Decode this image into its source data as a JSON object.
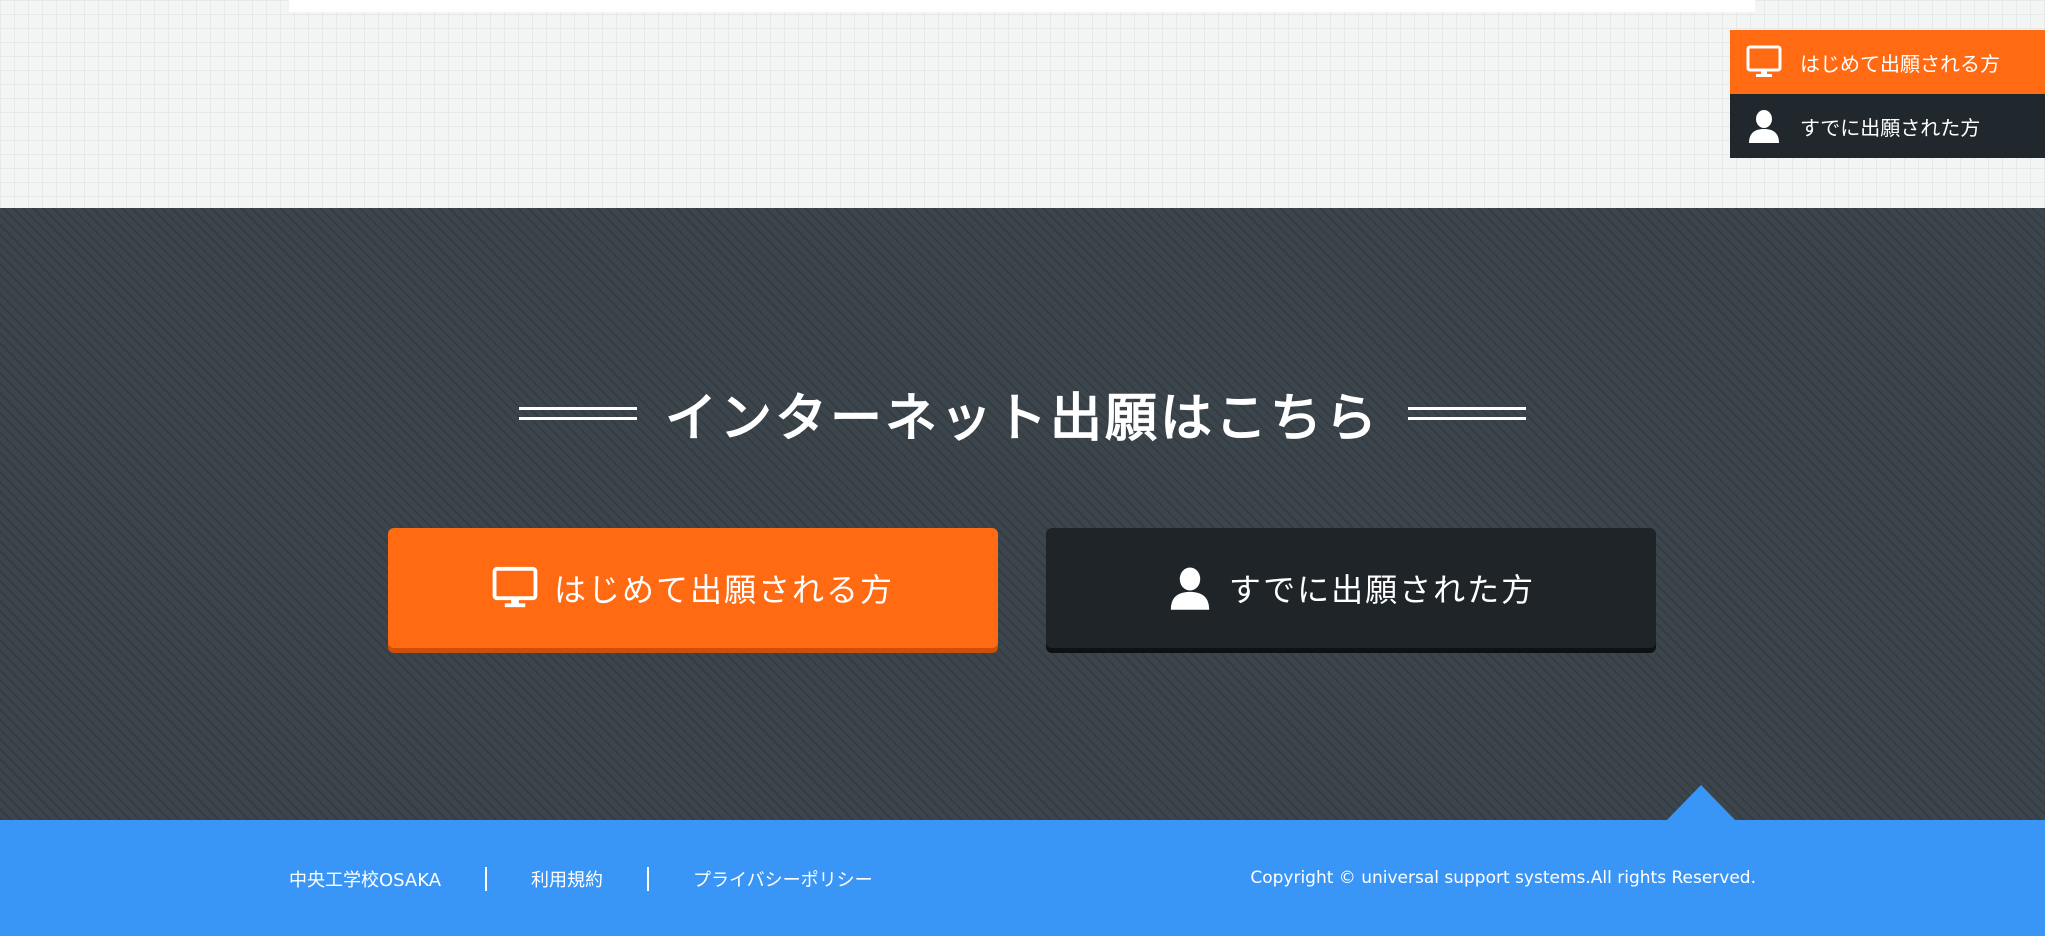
{
  "side_nav": {
    "new_applicant_label": "はじめて出願される方",
    "existing_applicant_label": "すでに出願された方"
  },
  "apply_section": {
    "title": "インターネット出願はこちら",
    "new_applicant_button": "はじめて出願される方",
    "existing_applicant_button": "すでに出願された方"
  },
  "footer": {
    "links": [
      {
        "label": "中央工学校OSAKA"
      },
      {
        "label": "利用規約"
      },
      {
        "label": "プライバシーポリシー"
      }
    ],
    "copyright": "Copyright © universal support systems.All rights Reserved."
  },
  "icons": {
    "monitor": "monitor-icon",
    "user": "user-icon",
    "page_top": "chevron-up-icon"
  },
  "colors": {
    "accent_orange": "#ff6a13",
    "dark": "#21282d",
    "section_bg": "#3b454b",
    "footer_blue": "#3a96f6"
  }
}
